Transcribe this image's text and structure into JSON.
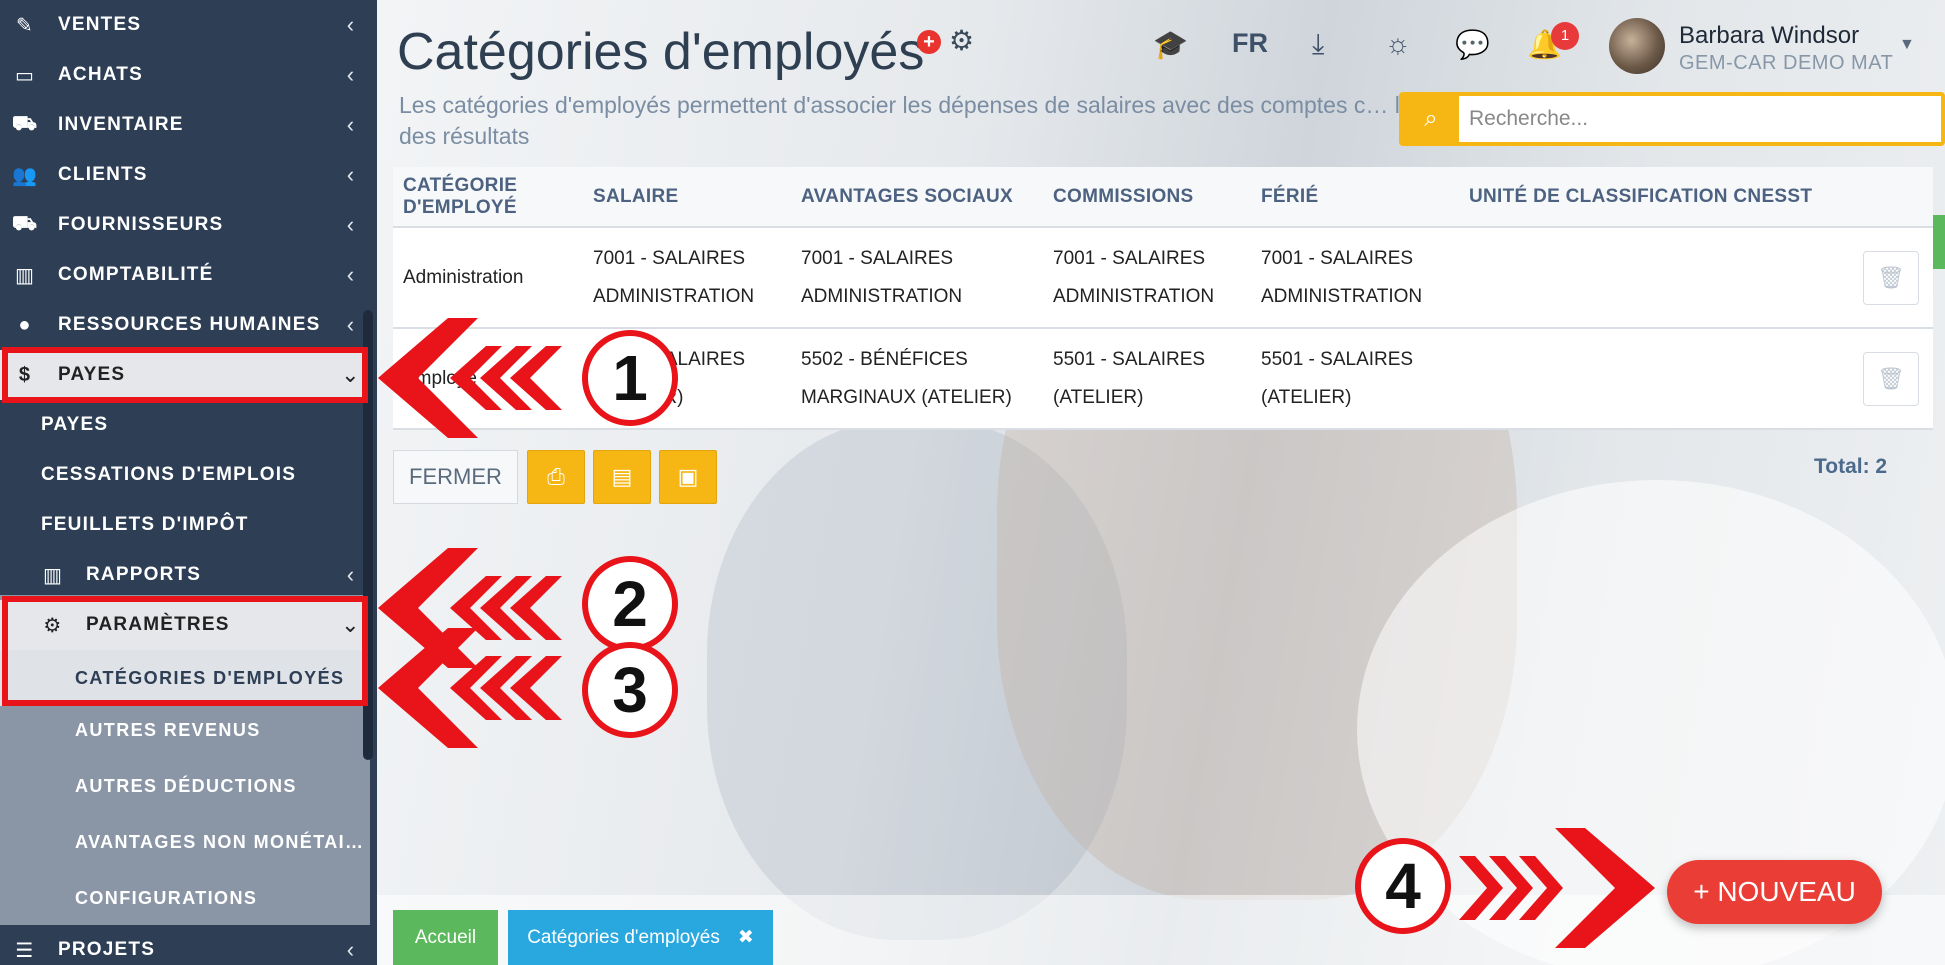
{
  "sidebar": {
    "items": [
      {
        "label": "VENTES",
        "icon": "pencil-icon"
      },
      {
        "label": "ACHATS",
        "icon": "credit-card-icon"
      },
      {
        "label": "INVENTAIRE",
        "icon": "cart-icon"
      },
      {
        "label": "CLIENTS",
        "icon": "users-icon"
      },
      {
        "label": "FOURNISSEURS",
        "icon": "truck-icon"
      },
      {
        "label": "COMPTABILITÉ",
        "icon": "bar-chart-icon"
      },
      {
        "label": "RESSOURCES HUMAINES",
        "icon": "user-icon"
      },
      {
        "label": "PAYES",
        "icon": "dollar-icon"
      }
    ],
    "payes_sub": [
      "PAYES",
      "CESSATIONS D'EMPLOIS",
      "FEUILLETS D'IMPÔT"
    ],
    "rapports": "RAPPORTS",
    "parametres": "PARAMÈTRES",
    "param_sub": [
      "CATÉGORIES D'EMPLOYÉS",
      "AUTRES REVENUS",
      "AUTRES DÉDUCTIONS",
      "AVANTAGES NON MONÉTAI…",
      "CONFIGURATIONS"
    ],
    "projets": "PROJETS"
  },
  "header": {
    "title": "Catégories d'employés",
    "subtitle": "Les catégories d'employés permettent d'associer les dépenses de salaires avec des comptes c… l'état des résultats",
    "lang": "FR",
    "notification_count": "1",
    "user_name": "Barbara Windsor",
    "company": "GEM-CAR DEMO MAT"
  },
  "search": {
    "placeholder": "Recherche..."
  },
  "table": {
    "headers": [
      "CATÉGORIE D'EMPLOYÉ",
      "SALAIRE",
      "AVANTAGES SOCIAUX",
      "COMMISSIONS",
      "FÉRIÉ",
      "UNITÉ DE CLASSIFICATION CNESST"
    ],
    "rows": [
      {
        "categorie": "Administration",
        "salaire": [
          "7001 - SALAIRES",
          "ADMINISTRATION"
        ],
        "avantages": [
          "7001 - SALAIRES",
          "ADMINISTRATION"
        ],
        "commissions": [
          "7001 - SALAIRES",
          "ADMINISTRATION"
        ],
        "ferie": [
          "7001 - SALAIRES",
          "ADMINISTRATION"
        ],
        "cnesst": ""
      },
      {
        "categorie": "Employé",
        "salaire": [
          "5501 - SALAIRES",
          "(ATELIER)"
        ],
        "avantages": [
          "5502 - BÉNÉFICES",
          "MARGINAUX (ATELIER)"
        ],
        "commissions": [
          "5501 - SALAIRES",
          "(ATELIER)"
        ],
        "ferie": [
          "5501 - SALAIRES",
          "(ATELIER)"
        ],
        "cnesst": ""
      }
    ]
  },
  "actions": {
    "close": "FERMER",
    "total": "Total: 2",
    "new": "+ NOUVEAU"
  },
  "tabs": {
    "home": "Accueil",
    "current": "Catégories d'employés"
  },
  "steps": [
    "1",
    "2",
    "3",
    "4"
  ],
  "colors": {
    "sidebar": "#2d3e55",
    "accent_yellow": "#f6b613",
    "accent_red": "#ea3d35",
    "annotation_red": "#e8141a",
    "green": "#5cb85c",
    "blue_tab": "#29a8e0"
  }
}
